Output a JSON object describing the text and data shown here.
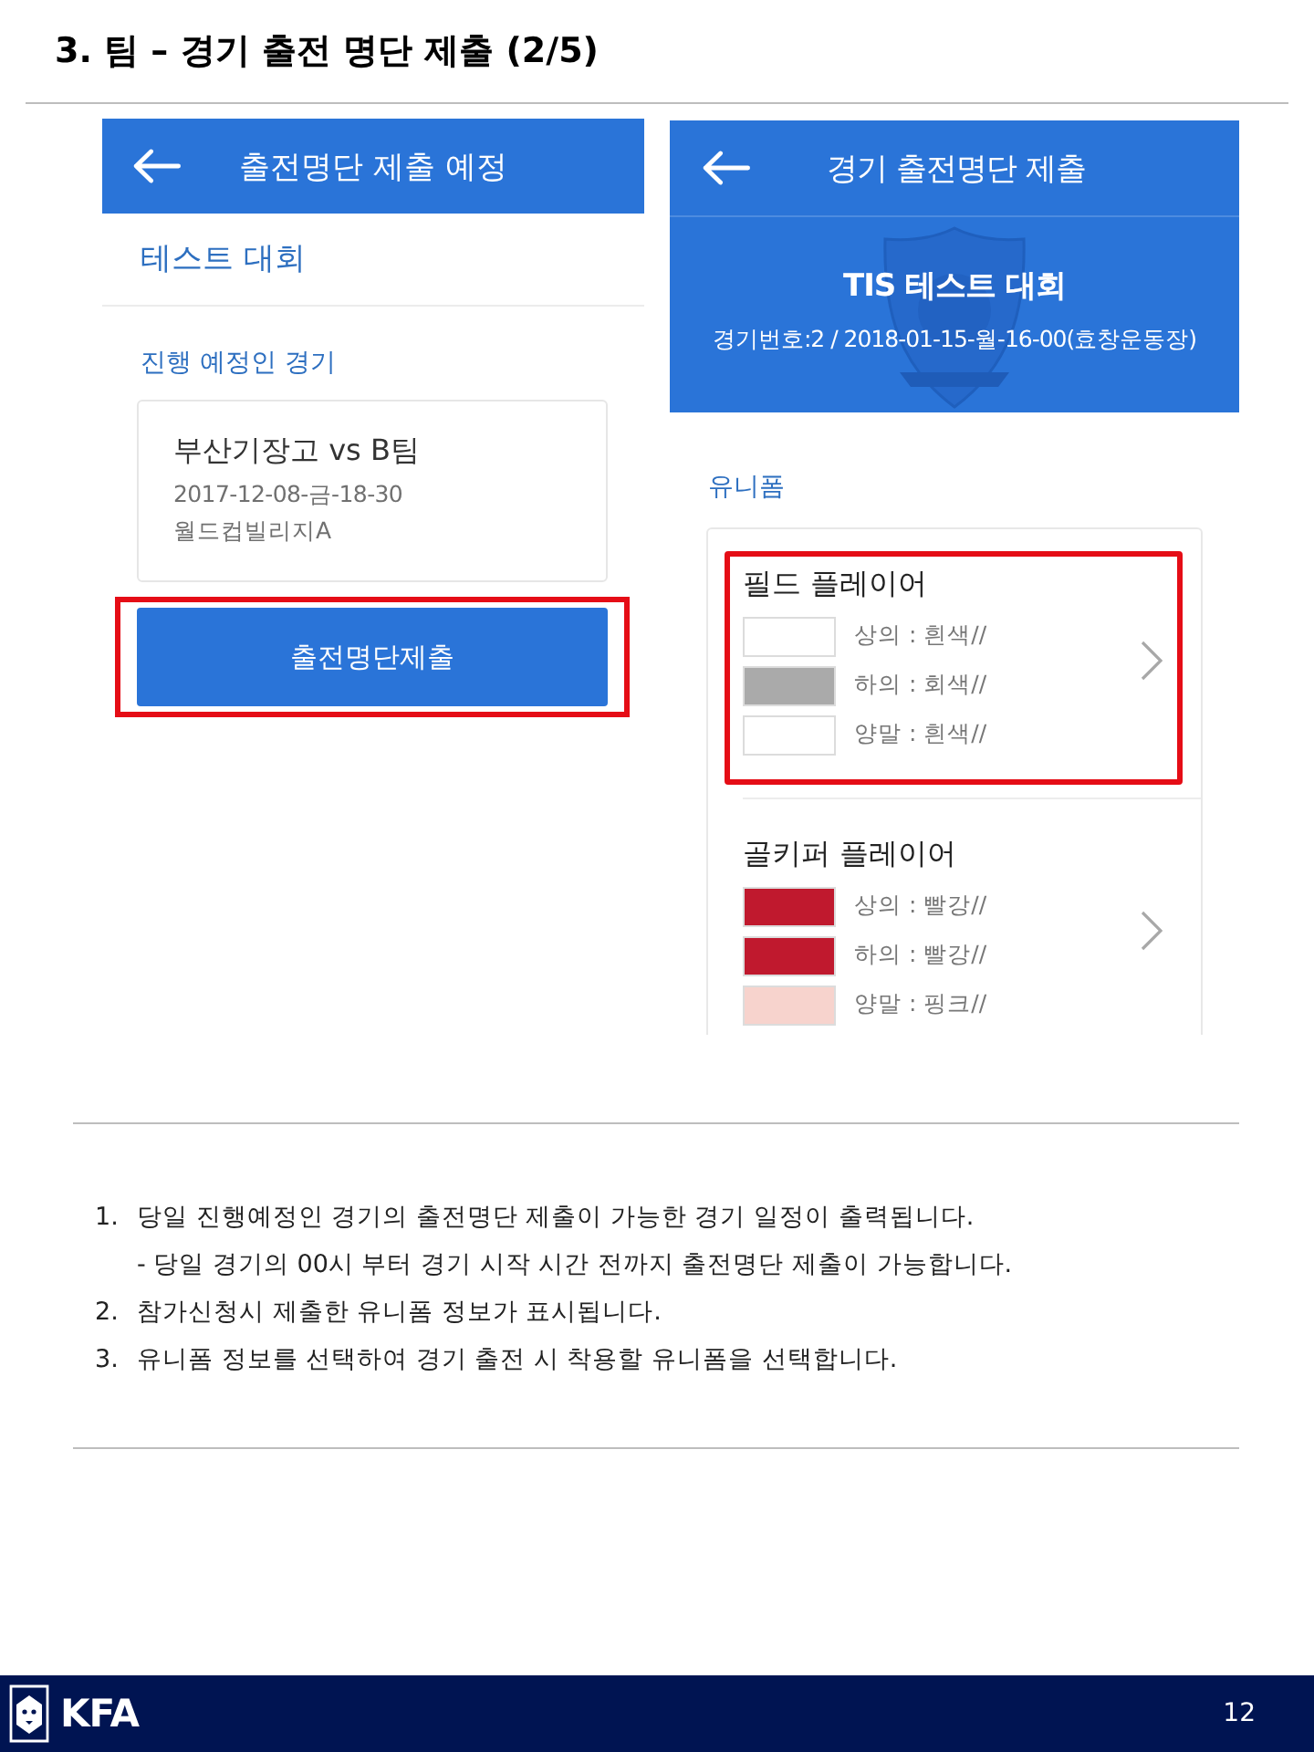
{
  "slide_title": "3. 팀 – 경기 출전 명단 제출 (2/5)",
  "upcoming_screen": {
    "header": {
      "title": "출전명단 제출 예정"
    },
    "competition": "테스트 대회",
    "section_label": "진행 예정인 경기",
    "match": {
      "teams": "부산기장고 vs B팀",
      "date": "2017-12-08-금-18-30",
      "venue": "월드컵빌리지A"
    },
    "submit_button": {
      "label": "출전명단제출",
      "highlighted": true
    }
  },
  "submission_screen": {
    "header": {
      "title": "경기 출전명단 제출"
    },
    "banner": {
      "title": "TIS 테스트 대회",
      "subtitle": "경기번호:2 / 2018-01-15-월-16-00(효창운동장)"
    },
    "section_label": "유니폼",
    "uniforms": [
      {
        "title": "필드 플레이어",
        "highlighted": true,
        "items": [
          {
            "label": "상의 : 흰색//",
            "color": "#ffffff"
          },
          {
            "label": "하의 : 회색//",
            "color": "#aaaaaa"
          },
          {
            "label": "양말 : 흰색//",
            "color": "#ffffff"
          }
        ]
      },
      {
        "title": "골키퍼 플레이어",
        "highlighted": false,
        "items": [
          {
            "label": "상의 : 빨강//",
            "color": "#c0192e"
          },
          {
            "label": "하의 : 빨강//",
            "color": "#c0192e"
          },
          {
            "label": "양말 : 핑크//",
            "color": "#f7d3cd"
          }
        ]
      }
    ]
  },
  "notes": [
    {
      "number": "1.",
      "text": "당일 진행예정인 경기의 출전명단 제출이 가능한 경기 일정이 출력됩니다.",
      "sub": "- 당일 경기의 00시 부터 경기 시작 시간 전까지 출전명단 제출이 가능합니다."
    },
    {
      "number": "2.",
      "text": "참가신청시 제출한 유니폼 정보가 표시됩니다."
    },
    {
      "number": "3.",
      "text": "유니폼 정보를 선택하여 경기 출전 시 착용할 유니폼을 선택합니다."
    }
  ],
  "footer": {
    "logo_text": "KFA",
    "page_number": "12"
  }
}
